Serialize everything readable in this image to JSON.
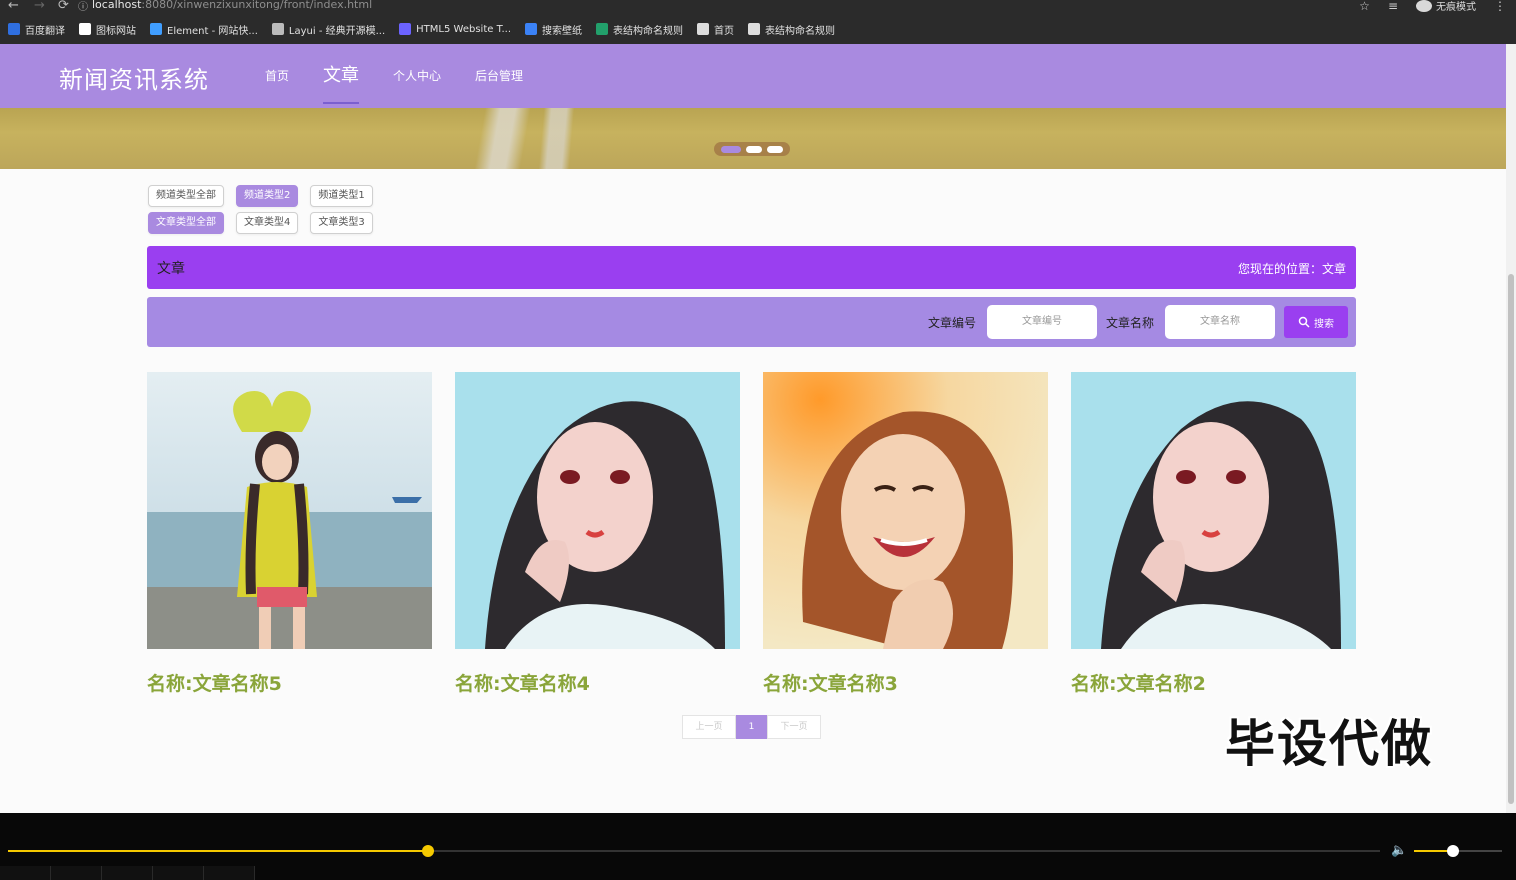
{
  "browser": {
    "url_host": "localhost",
    "url_path": ":8080/xinwenzixunxitong/front/index.html",
    "incognito_label": "无痕模式",
    "bookmarks": [
      {
        "label": "百度翻译",
        "color": "#2f6fe0"
      },
      {
        "label": "图标网站",
        "color": "#ffffff"
      },
      {
        "label": "Element - 网站快...",
        "color": "#409eff"
      },
      {
        "label": "Layui - 经典开源模...",
        "color": "#bbbbbb"
      },
      {
        "label": "HTML5 Website T...",
        "color": "#6c63ff"
      },
      {
        "label": "搜索壁纸",
        "color": "#3b82f6"
      },
      {
        "label": "表结构命名规则",
        "color": "#22a06b"
      },
      {
        "label": "首页",
        "color": "#dddddd"
      },
      {
        "label": "表结构命名规则",
        "color": "#dddddd"
      }
    ]
  },
  "header": {
    "site_title": "新闻资讯系统",
    "nav": [
      {
        "label": "首页",
        "active": false
      },
      {
        "label": "文章",
        "active": true
      },
      {
        "label": "个人中心",
        "active": false
      },
      {
        "label": "后台管理",
        "active": false
      }
    ]
  },
  "banner": {
    "slides": 3,
    "active_slide": 1
  },
  "filters": {
    "channel": [
      "频道类型全部",
      "频道类型2",
      "频道类型1"
    ],
    "channel_active": 1,
    "article": [
      "文章类型全部",
      "文章类型4",
      "文章类型3"
    ],
    "article_active": 0
  },
  "breadcrumb": {
    "title": "文章",
    "location": "您现在的位置：文章"
  },
  "search": {
    "label_id": "文章编号",
    "placeholder_id": "文章编号",
    "label_name": "文章名称",
    "placeholder_name": "文章名称",
    "button": "搜索"
  },
  "articles": [
    {
      "name": "名称:文章名称5"
    },
    {
      "name": "名称:文章名称4"
    },
    {
      "name": "名称:文章名称3"
    },
    {
      "name": "名称:文章名称2"
    }
  ],
  "pager": {
    "prev": "上一页",
    "current": "1",
    "next": "下一页"
  },
  "watermark": "毕设代做",
  "player": {
    "progress": 0.306,
    "volume": 0.44
  },
  "colors": {
    "header": "#a98ae0",
    "accent": "#9a3ff0",
    "title_green": "#8aa53a"
  }
}
